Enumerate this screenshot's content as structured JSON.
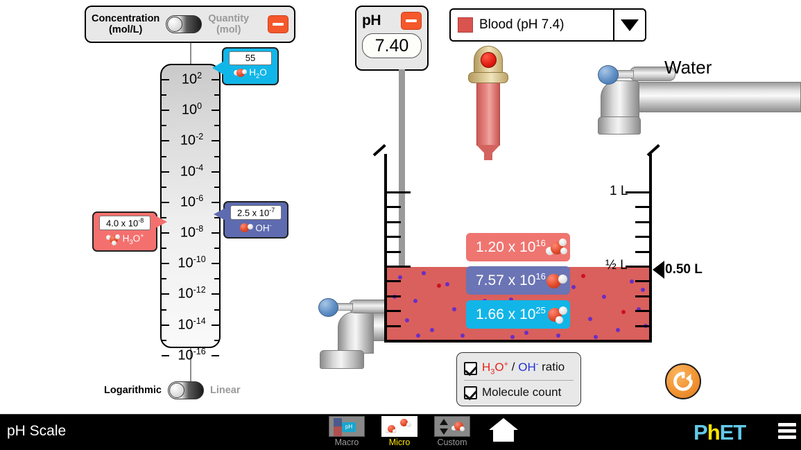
{
  "concentration_panel": {
    "left_label_line1": "Concentration",
    "left_label_line2": "(mol/L)",
    "right_label_line1": "Quantity",
    "right_label_line2": "(mol)",
    "selected": "Concentration",
    "minus_icon": "minus-icon"
  },
  "graph": {
    "scale_type_selected": "Logarithmic",
    "log_label": "Logarithmic",
    "linear_label": "Linear",
    "tick_labels": [
      "10²",
      "10⁰",
      "10⁻²",
      "10⁻⁴",
      "10⁻⁶",
      "10⁻⁸",
      "10⁻¹⁰",
      "10⁻¹²",
      "10⁻¹⁴",
      "10⁻¹⁶"
    ],
    "tick_bases": [
      "10",
      "10",
      "10",
      "10",
      "10",
      "10",
      "10",
      "10",
      "10",
      "10"
    ],
    "tick_exponents": [
      "2",
      "0",
      "-2",
      "-4",
      "-6",
      "-8",
      "-10",
      "-12",
      "-14",
      "-16"
    ],
    "callouts": [
      {
        "id": "h2o",
        "value": "55",
        "species_name": "H2O",
        "species_prefix": "H",
        "species_sub": "2",
        "species_suffix": "O",
        "species_sup": "",
        "color": "#11b6e8"
      },
      {
        "id": "oh",
        "value_mantissa": "2.5 x 10",
        "value_exponent": "-7",
        "species_prefix": "OH",
        "species_sub": "",
        "species_suffix": "",
        "species_sup": "-",
        "color": "#5e6bb0"
      },
      {
        "id": "h3o",
        "value_mantissa": "4.0 x 10",
        "value_exponent": "-8",
        "species_prefix": "H",
        "species_sub": "3",
        "species_suffix": "O",
        "species_sup": "+",
        "color": "#f4706e"
      }
    ]
  },
  "ph_meter": {
    "label": "pH",
    "value": "7.40",
    "minus_icon": "minus-icon"
  },
  "solution_selector": {
    "selected_label": "Blood (pH 7.4)",
    "swatch_color": "#d9534f",
    "arrow_icon": "chevron-down-icon"
  },
  "water_faucet": {
    "label": "Water"
  },
  "beaker": {
    "volume_marker_label": "0.50 L",
    "tick_label_full": "1 L",
    "tick_label_half": "½ L",
    "solution_color": "#d9605c"
  },
  "molecule_counts": [
    {
      "id": "h3o-count",
      "mantissa": "1.20 x 10",
      "exponent": "16",
      "species": "H3O+",
      "color": "#ef7570"
    },
    {
      "id": "oh-count",
      "mantissa": "7.57 x 10",
      "exponent": "16",
      "species": "OH-",
      "color": "#6b74b4"
    },
    {
      "id": "h2o-count",
      "mantissa": "1.66 x 10",
      "exponent": "25",
      "species": "H2O",
      "color": "#12b5e7"
    }
  ],
  "view_controls": {
    "ratio_checkbox": {
      "checked": true,
      "part1": "H",
      "part1_sub": "3",
      "part1_mid": "O",
      "part1_sup": "+",
      "separator": " / ",
      "part2": "OH",
      "part2_sup": "-",
      "suffix": " ratio"
    },
    "molecule_count_checkbox": {
      "checked": true,
      "label": "Molecule count"
    }
  },
  "reset_all": {
    "icon": "reset-circular-arrow-icon"
  },
  "navbar": {
    "title": "pH Scale",
    "tabs": [
      {
        "id": "macro",
        "label": "Macro",
        "active": false
      },
      {
        "id": "micro",
        "label": "Micro",
        "active": true
      },
      {
        "id": "custom",
        "label": "Custom",
        "active": false
      }
    ],
    "home_icon": "home-icon",
    "logo_p": "P",
    "logo_h": "h",
    "logo_et": "ET",
    "menu_icon": "hamburger-menu-icon"
  }
}
